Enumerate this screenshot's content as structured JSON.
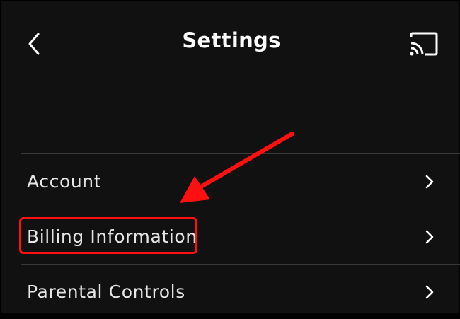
{
  "header": {
    "title": "Settings",
    "back_icon": "chevron-left-icon",
    "cast_icon": "cast-icon"
  },
  "menu": {
    "items": [
      {
        "label": "Account",
        "icon": "chevron-right-icon"
      },
      {
        "label": "Billing Information",
        "icon": "chevron-right-icon",
        "highlighted": true
      },
      {
        "label": "Parental Controls",
        "icon": "chevron-right-icon"
      }
    ]
  },
  "colors": {
    "background": "#111111",
    "text": "#e6e6e6",
    "divider": "#3a3a3a",
    "annotation": "#ff1010"
  }
}
